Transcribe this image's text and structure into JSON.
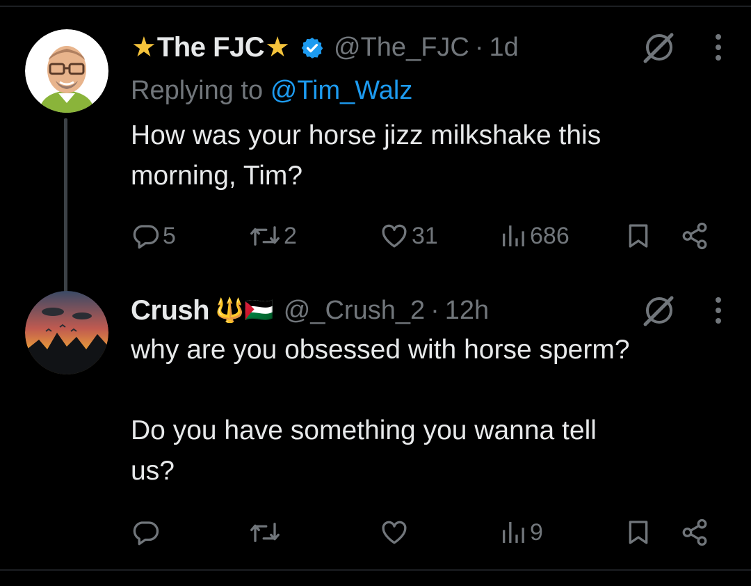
{
  "tweets": [
    {
      "display_name": "The FJC",
      "name_emoji_left": "★",
      "name_emoji_right": "★",
      "verified": true,
      "handle": "@The_FJC",
      "separator": "·",
      "time": "1d",
      "replying_label": "Replying to",
      "replying_to": "@Tim_Walz",
      "text": "How was your horse jizz milkshake this\nmorning, Tim?",
      "reply_count": "5",
      "retweet_count": "2",
      "like_count": "31",
      "view_count": "686"
    },
    {
      "display_name": "Crush",
      "name_emoji": "🔱🇵🇸",
      "handle": "@_Crush_2",
      "separator": "·",
      "time": "12h",
      "text": "why are you obsessed with horse sperm?\n\nDo you have something you wanna tell\nus?",
      "view_count": "9"
    }
  ],
  "colors": {
    "background": "#000000",
    "text_primary": "#e7e9ea",
    "text_secondary": "#71767b",
    "link": "#1d9bf0",
    "verified": "#1d9bf0",
    "star": "#f5c33b",
    "thread_line": "#3c4146"
  },
  "icons": {
    "more": "more-options-icon",
    "grok": "grok-icon",
    "reply": "reply-icon",
    "retweet": "retweet-icon",
    "like": "heart-icon",
    "views": "views-bar-chart-icon",
    "bookmark": "bookmark-icon",
    "share": "share-icon",
    "verified": "verified-badge-icon"
  }
}
